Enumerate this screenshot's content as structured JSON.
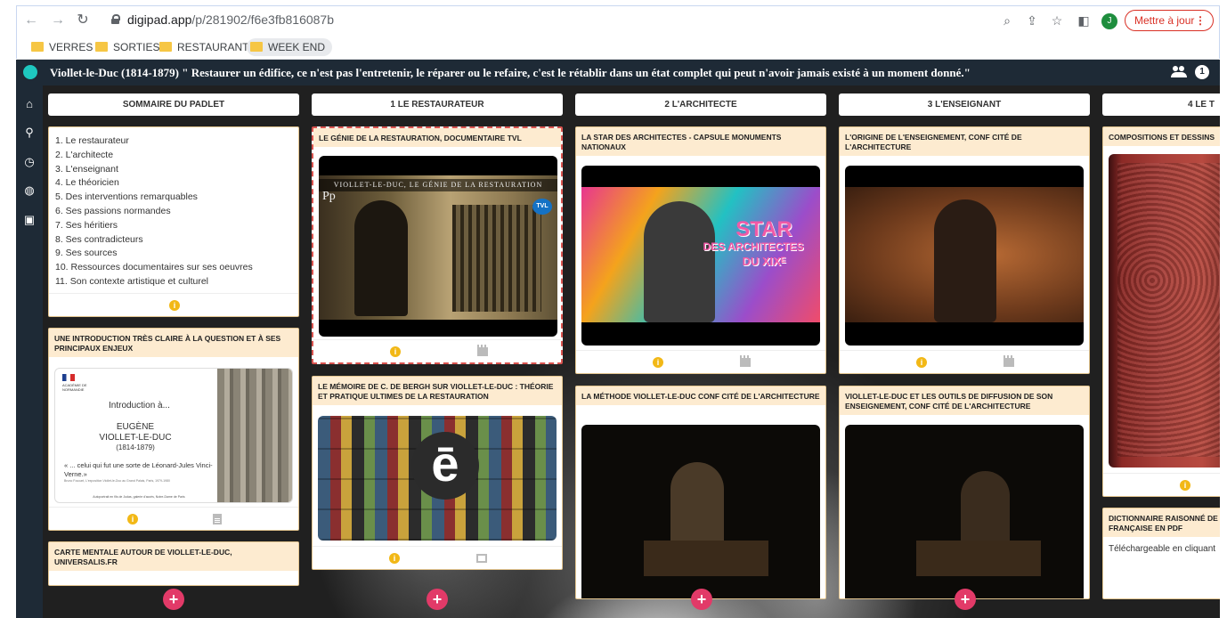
{
  "browser": {
    "url_domain": "digipad.app",
    "url_path": "/p/281902/f6e3fb816087b",
    "update_label": "Mettre à jour",
    "avatar_letter": "J",
    "bookmarks": [
      "VERRES",
      "SORTIES",
      "RESTAURANTS",
      "WEEK END"
    ]
  },
  "pad": {
    "title": "Viollet-le-Duc (1814-1879) \" Restaurer un édifice, ce n'est pas l'entretenir, le réparer ou le refaire, c'est le rétablir dans un état complet qui peut n'avoir jamais existé à un moment donné.\"",
    "users_count": "1"
  },
  "sidebar_icons": [
    "home-icon",
    "search-icon",
    "clock-icon",
    "globe-icon",
    "play-icon"
  ],
  "columns": [
    {
      "title": "SOMMAIRE DU PADLET"
    },
    {
      "title": "1 LE RESTAURATEUR"
    },
    {
      "title": "2 L'ARCHITECTE"
    },
    {
      "title": "3 L'ENSEIGNANT"
    },
    {
      "title": "4 LE T"
    }
  ],
  "summary": {
    "items": [
      "1. Le restaurateur",
      "2. L'architecte",
      "3. L'enseignant",
      "4. Le théoricien",
      "5. Des interventions remarquables",
      "6. Ses passions normandes",
      "7. Ses héritiers",
      "8. Ses contradicteurs",
      "9. Ses sources",
      "10. Ressources documentaires sur ses oeuvres",
      "11. Son contexte artistique et culturel"
    ]
  },
  "cards": {
    "intro_title": "UNE INTRODUCTION TRÈS CLAIRE À LA QUESTION ET À SES PRINCIPAUX ENJEUX",
    "intro_thumb": {
      "org": "ACADÉMIE DE NORMANDIE",
      "line1": "Introduction à...",
      "line2": "EUGÈNE",
      "line3": "VIOLLET-LE-DUC",
      "line4": "(1814-1879)",
      "quote": "« ... celui qui fut une sorte de Léonard-Jules Vinci-Verne.»",
      "quote_src": "Bruno Foucart, L'exposition Viollet-le-Duc au Grand Palais, Paris, 1979-1980",
      "caption": "Autoportrait en fils de Judas, galerie d'accès, Notre-Dame de Paris"
    },
    "carte_title": "CARTE MENTALE AUTOUR DE VIOLLET-LE-DUC, UNIVERSALIS.FR",
    "genie_title": "LE GÉNIE DE LA RESTAURATION, DOCUMENTAIRE TVL",
    "genie_banner": "VIOLLET-LE-DUC, LE GÉNIE DE LA RESTAURATION",
    "genie_badge": "TVL",
    "genie_pp": "Pp",
    "memoire_title": "LE MÉMOIRE DE C. DE BERGH SUR VIOLLET-LE-DUC : THÉORIE ET PRATIQUE ULTIMES DE LA RESTAURATION",
    "memoire_letter": "ē",
    "star_title": "LA STAR DES ARCHITECTES - CAPSULE MONUMENTS NATIONAUX",
    "star_text1": "STAR",
    "star_text2": "DES ARCHITECTES",
    "star_text3": "DU XIXᴱ",
    "methode_title": "LA MÉTHODE VIOLLET-LE-DUC CONF CITÉ DE L'ARCHITECTURE",
    "origine_title": "L'ORIGINE DE L'ENSEIGNEMENT, CONF CITÉ DE L'ARCHITECTURE",
    "outils_title": "VIOLLET-LE-DUC ET LES OUTILS DE DIFFUSION DE SON ENSEIGNEMENT, CONF CITÉ DE L'ARCHITECTURE",
    "compo_title": "COMPOSITIONS ET DESSINS",
    "dico_title": "DICTIONNAIRE RAISONNÉ DE FRANÇAISE EN PDF",
    "dico_text": "Téléchargeable en cliquant"
  },
  "colors": {
    "topbar": "#1e2a36",
    "card_title_bg": "#fdebd0",
    "card_border": "#e3c58f",
    "info": "#f2b816",
    "add": "#e23a68",
    "selected_border": "#d9534f"
  }
}
